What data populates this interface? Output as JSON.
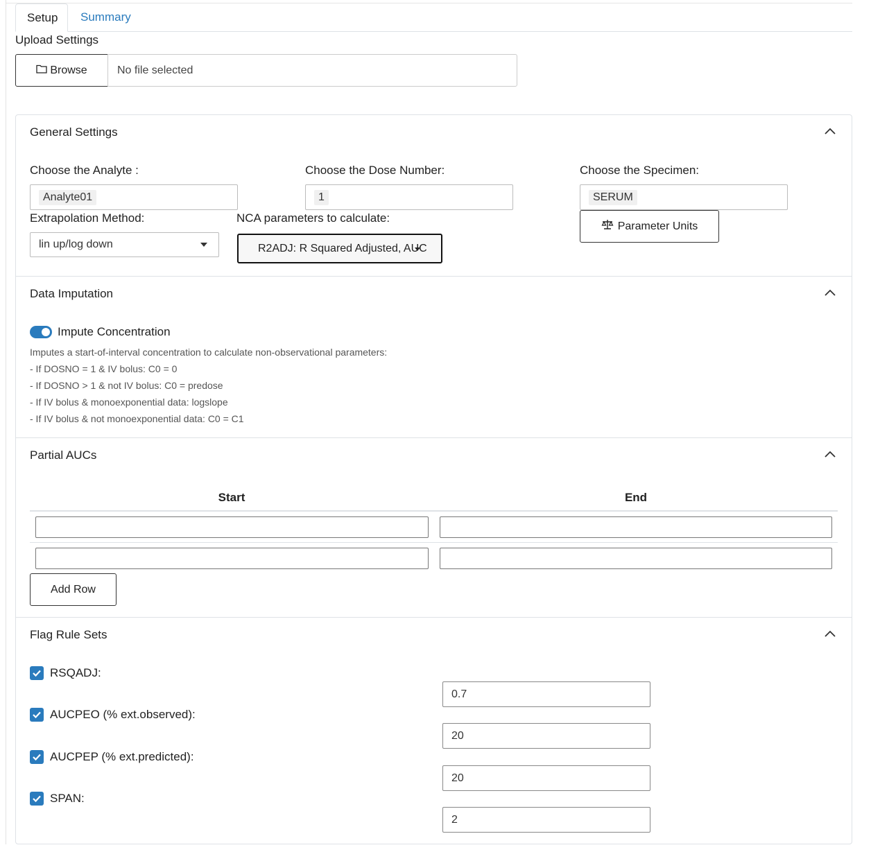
{
  "tabs": [
    {
      "label": "Setup",
      "active": true
    },
    {
      "label": "Summary",
      "active": false
    }
  ],
  "upload": {
    "label": "Upload Settings",
    "browse_label": "Browse",
    "file_status": "No file selected"
  },
  "general": {
    "title": "General Settings",
    "analyte_label": "Choose the Analyte :",
    "analyte_value": "Analyte01",
    "dose_label": "Choose the Dose Number:",
    "dose_value": "1",
    "specimen_label": "Choose the Specimen:",
    "specimen_value": "SERUM",
    "extrap_label": "Extrapolation Method:",
    "extrap_value": "lin up/log down",
    "nca_label": "NCA parameters to calculate:",
    "nca_value": "R2ADJ: R Squared Adjusted, AUC",
    "units_button": "Parameter Units"
  },
  "imputation": {
    "title": "Data Imputation",
    "toggle_label": "Impute Concentration",
    "toggle_on": true,
    "help_lines": [
      "Imputes a start-of-interval concentration to calculate non-observational parameters:",
      "- If DOSNO = 1 & IV bolus: C0 = 0",
      "- If DOSNO > 1 & not IV bolus: C0 = predose",
      "- If IV bolus & monoexponential data: logslope",
      "- If IV bolus & not monoexponential data: C0 = C1"
    ]
  },
  "partial_aucs": {
    "title": "Partial AUCs",
    "columns": [
      "Start",
      "End"
    ],
    "rows": [
      [
        "",
        ""
      ],
      [
        "",
        ""
      ]
    ],
    "add_row_label": "Add Row"
  },
  "flags": {
    "title": "Flag Rule Sets",
    "rules": [
      {
        "label": "RSQADJ:",
        "checked": true,
        "value": "0.7"
      },
      {
        "label": "AUCPEO (% ext.observed):",
        "checked": true,
        "value": "20"
      },
      {
        "label": "AUCPEP (% ext.predicted):",
        "checked": true,
        "value": "20"
      },
      {
        "label": "SPAN:",
        "checked": true,
        "value": "2"
      }
    ]
  },
  "icons": {
    "folder": "folder-icon",
    "scale": "scale-icon",
    "chevron": "chevron-up-icon",
    "check": "check-icon"
  },
  "colors": {
    "accent": "#2a7bbd",
    "border": "#dee2e6"
  }
}
